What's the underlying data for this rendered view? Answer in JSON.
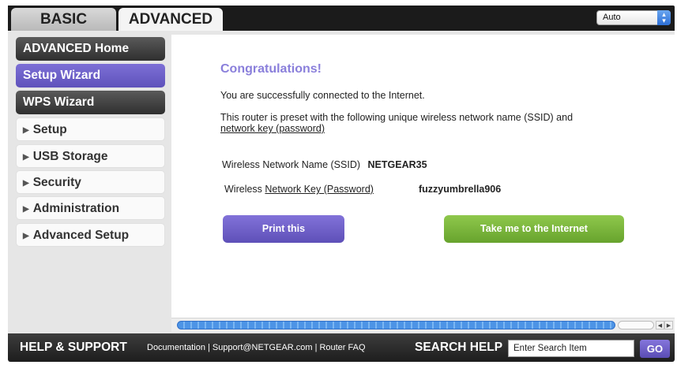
{
  "tabs": {
    "basic": "BASIC",
    "advanced": "ADVANCED",
    "active": "advanced"
  },
  "language_select": {
    "value": "Auto"
  },
  "sidebar": {
    "items": [
      {
        "label": "ADVANCED Home",
        "style": "dark"
      },
      {
        "label": "Setup Wizard",
        "style": "purple",
        "selected": true
      },
      {
        "label": "WPS Wizard",
        "style": "dark"
      },
      {
        "label": "Setup",
        "style": "light",
        "expandable": true
      },
      {
        "label": "USB Storage",
        "style": "light",
        "expandable": true
      },
      {
        "label": "Security",
        "style": "light",
        "expandable": true
      },
      {
        "label": "Administration",
        "style": "light",
        "expandable": true
      },
      {
        "label": "Advanced Setup",
        "style": "light",
        "expandable": true
      }
    ]
  },
  "content": {
    "heading": "Congratulations!",
    "line1": "You are successfully connected to the Internet.",
    "line2a": "This router is preset with the following unique wireless network name (SSID) and",
    "line2b": "network key (password)",
    "ssid_label": "Wireless Network Name (SSID)",
    "ssid_value": "NETGEAR35",
    "key_label_prefix": "Wireless ",
    "key_label_link": "Network Key (Password)",
    "key_value": "fuzzyumbrella906",
    "print_button": "Print this",
    "internet_button": "Take me to the Internet"
  },
  "footer": {
    "help_title": "HELP & SUPPORT",
    "links": [
      "Documentation",
      "Support@NETGEAR.com",
      "Router FAQ"
    ],
    "search_title": "SEARCH HELP",
    "search_placeholder": "Enter Search Item",
    "go_label": "GO"
  },
  "colors": {
    "accent_purple": "#6b5ec7",
    "accent_green": "#7ab63a",
    "heading_purple": "#8a7fdb"
  }
}
